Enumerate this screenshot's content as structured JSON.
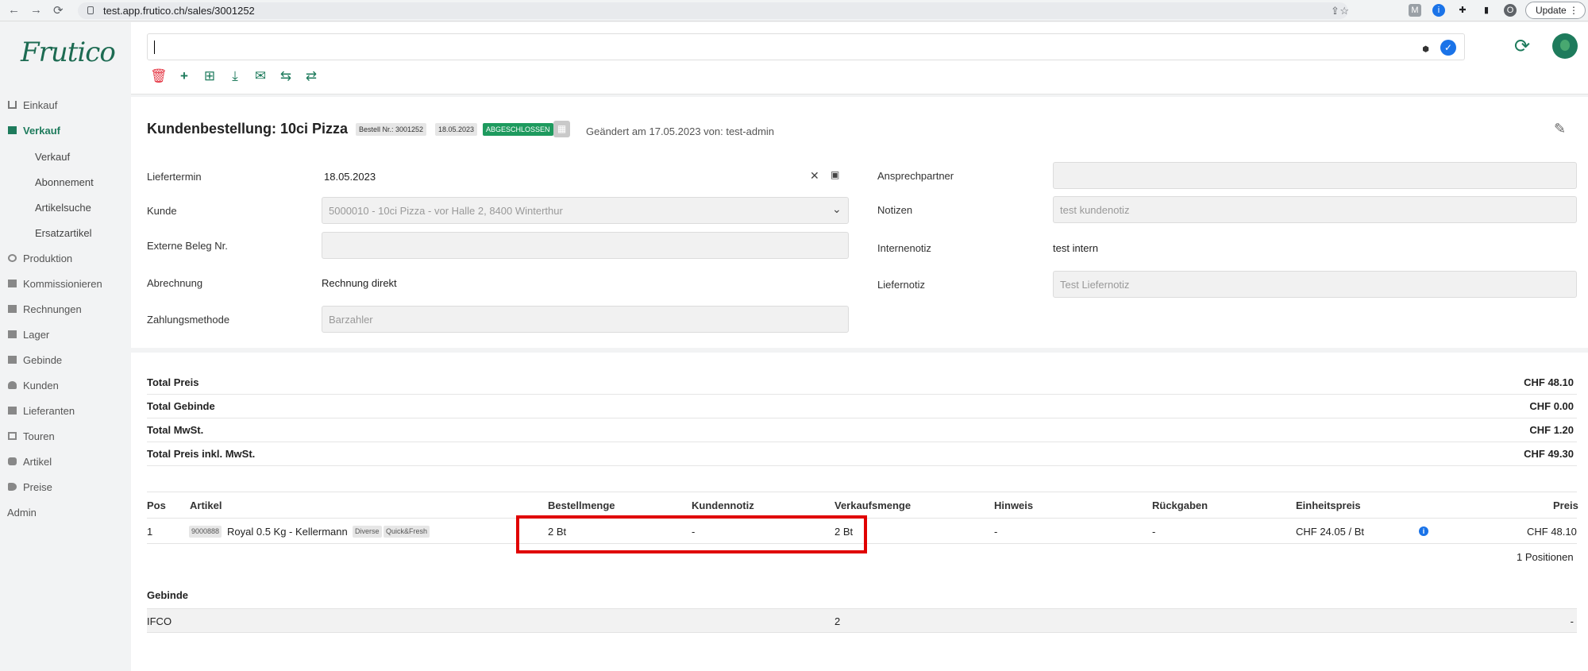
{
  "browser": {
    "url": "test.app.frutico.ch/sales/3001252",
    "profile_initial": "O",
    "update_label": "Update"
  },
  "brand": {
    "logo_text": "Frutico",
    "accent": "#1e7b5c"
  },
  "sidebar": {
    "items": [
      {
        "label": "Einkauf",
        "icon": "cart-icon"
      },
      {
        "label": "Verkauf",
        "icon": "store-icon",
        "active": true
      },
      {
        "label": "Produktion",
        "icon": "gears-icon"
      },
      {
        "label": "Kommissionieren",
        "icon": "clipboard-icon"
      },
      {
        "label": "Rechnungen",
        "icon": "invoice-icon"
      },
      {
        "label": "Lager",
        "icon": "boxes-icon"
      },
      {
        "label": "Gebinde",
        "icon": "crate-icon"
      },
      {
        "label": "Kunden",
        "icon": "user-icon"
      },
      {
        "label": "Lieferanten",
        "icon": "truck-icon"
      },
      {
        "label": "Touren",
        "icon": "route-icon"
      },
      {
        "label": "Artikel",
        "icon": "cube-icon"
      },
      {
        "label": "Preise",
        "icon": "tag-icon"
      },
      {
        "label": "Admin",
        "icon": ""
      }
    ],
    "sub_items": [
      "Verkauf",
      "Abonnement",
      "Artikelsuche",
      "Ersatzartikel"
    ]
  },
  "header": {
    "title": "Kundenbestellung: 10ci Pizza",
    "order_badge": "Bestell Nr.: 3001252",
    "date_badge": "18.05.2023",
    "status_badge": "ABGESCHLOSSEN",
    "changed_text": "Geändert am 17.05.2023 von: test-admin"
  },
  "form": {
    "liefertermin_label": "Liefertermin",
    "liefertermin_value": "18.05.2023",
    "kunde_label": "Kunde",
    "kunde_value": "5000010 - 10ci Pizza - vor Halle 2, 8400 Winterthur",
    "externe_label": "Externe Beleg Nr.",
    "externe_value": "",
    "abrechnung_label": "Abrechnung",
    "abrechnung_value": "Rechnung direkt",
    "zahlung_label": "Zahlungsmethode",
    "zahlung_value": "Barzahler",
    "ansprech_label": "Ansprechpartner",
    "ansprech_value": "",
    "notizen_label": "Notizen",
    "notizen_value": "test kundenotiz",
    "interne_label": "Internenotiz",
    "interne_value": "test intern",
    "liefernotiz_label": "Liefernotiz",
    "liefernotiz_value": "Test Liefernotiz"
  },
  "totals": [
    {
      "label": "Total Preis",
      "value": "CHF 48.10"
    },
    {
      "label": "Total Gebinde",
      "value": "CHF 0.00"
    },
    {
      "label": "Total MwSt.",
      "value": "CHF 1.20"
    },
    {
      "label": "Total Preis inkl. MwSt.",
      "value": "CHF 49.30"
    }
  ],
  "items_table": {
    "headers": [
      "Pos",
      "Artikel",
      "Bestellmenge",
      "Kundennotiz",
      "Verkaufsmenge",
      "Hinweis",
      "Rückgaben",
      "Einheitspreis",
      "Preis"
    ],
    "rows": [
      {
        "pos": "1",
        "article_code": "9000888",
        "article": "Royal 0.5 Kg - Kellermann",
        "tags": [
          "Diverse",
          "Quick&Fresh"
        ],
        "bestellmenge": "2 Bt",
        "kundennotiz": "-",
        "verkaufsmenge": "2 Bt",
        "hinweis": "-",
        "rueckgaben": "-",
        "einheitspreis": "CHF 24.05 / Bt",
        "preis": "CHF 48.10"
      }
    ],
    "positions_count": "1 Positionen"
  },
  "gebinde": {
    "header": "Gebinde",
    "rows": [
      {
        "name": "IFCO",
        "qty": "2",
        "value": "-"
      }
    ]
  }
}
